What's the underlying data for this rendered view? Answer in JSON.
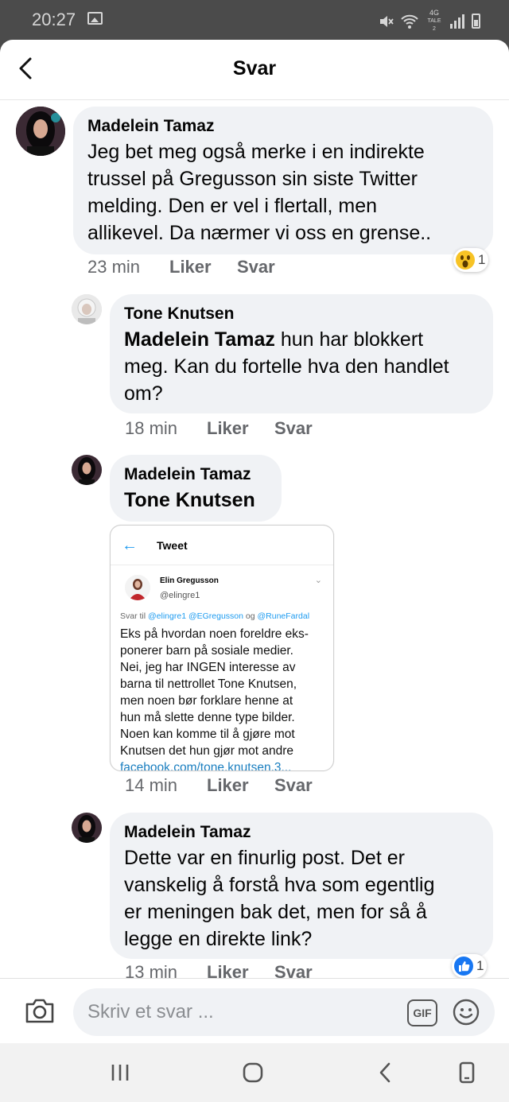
{
  "status_bar": {
    "time": "20:27",
    "network": "4G",
    "network_sub": "TALE 2"
  },
  "header": {
    "title": "Svar"
  },
  "comments": [
    {
      "author": "Madelein Tamaz",
      "text_lines": [
        "Jeg bet meg også merke i en indirekte",
        "trussel på Gregusson sin siste Twitter",
        "melding. Den er vel i flertall, men",
        "allikevel. Da nærmer vi oss en grense.."
      ],
      "time": "23 min",
      "like": "Liker",
      "reply": "Svar",
      "reaction": {
        "icon": "wow-emoji-icon",
        "count": "1"
      }
    },
    {
      "author": "Tone Knutsen",
      "mention": "Madelein Tamaz",
      "text_first": " hun har blokkert",
      "text_lines": [
        "meg. Kan du fortelle hva den handlet",
        "om?"
      ],
      "time": "18 min",
      "like": "Liker",
      "reply": "Svar"
    },
    {
      "author": "Madelein Tamaz",
      "mention": "Tone Knutsen",
      "time": "14 min",
      "like": "Liker",
      "reply": "Svar",
      "tweet": {
        "header": "Tweet",
        "name": "Elin Gregusson",
        "handle": "@elingre1",
        "reply_prefix": "Svar til ",
        "reply_users": "@elingre1 @EGregusson",
        "reply_and": " og ",
        "reply_last": "@RuneFardal",
        "lines": [
          "Eks på hvordan noen foreldre eks-",
          "ponerer barn på sosiale medier.",
          "Nei, jeg har INGEN interesse av",
          "barna til nettrollet Tone Knutsen,",
          "men noen bør forklare henne at",
          "hun må slette denne type bilder.",
          "Noen kan komme til å gjøre mot",
          "Knutsen det hun gjør mot andre"
        ],
        "link": "facebook.com/tone.knutsen.3..."
      }
    },
    {
      "author": "Madelein Tamaz",
      "text_lines": [
        "Dette var en finurlig post. Det er",
        "vanskelig å forstå hva som egentlig",
        "er meningen bak det, men for så å",
        "legge en direkte link?"
      ],
      "time": "13 min",
      "like": "Liker",
      "reply": "Svar",
      "reaction": {
        "icon": "like-thumb-icon",
        "count": "1"
      }
    }
  ],
  "composer": {
    "placeholder": "Skriv et svar ...",
    "gif_label": "GIF"
  },
  "colors": {
    "bubble": "#f0f2f5",
    "link": "#1b7fc0",
    "facebook_blue": "#1877f2"
  }
}
